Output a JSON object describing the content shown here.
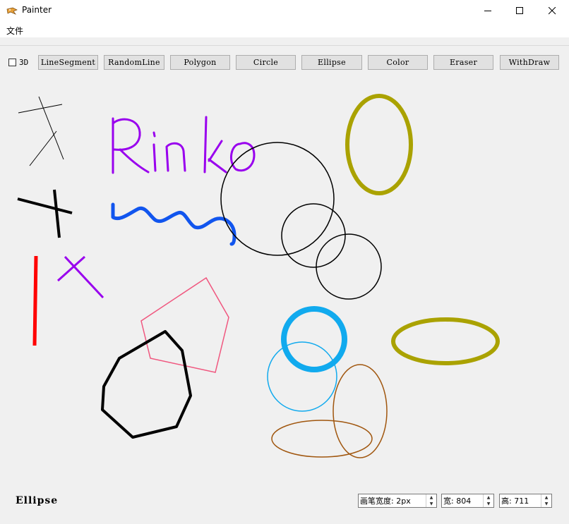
{
  "window": {
    "title": "Painter",
    "app_icon": "painter-app-icon",
    "controls": {
      "minimize_icon": "minimize-icon",
      "maximize_icon": "maximize-icon",
      "close_icon": "close-icon"
    }
  },
  "menu": {
    "file_label": "文件"
  },
  "toolbar": {
    "checkbox_3d": {
      "label": "3D",
      "checked": false
    },
    "buttons": [
      {
        "id": "linesegment",
        "label": "LineSegment"
      },
      {
        "id": "randomline",
        "label": "RandomLine"
      },
      {
        "id": "polygon",
        "label": "Polygon"
      },
      {
        "id": "circle",
        "label": "Circle"
      },
      {
        "id": "ellipse",
        "label": "Ellipse"
      },
      {
        "id": "color",
        "label": "Color"
      },
      {
        "id": "eraser",
        "label": "Eraser"
      },
      {
        "id": "withdraw",
        "label": "WithDraw"
      }
    ]
  },
  "canvas": {
    "drawn_text": "Rinko",
    "colors": {
      "black": "#000000",
      "purple": "#9900ee",
      "blue": "#1155ee",
      "red": "#ff0000",
      "pink": "#f0577f",
      "olive": "#aaa200",
      "cyan": "#11aaee",
      "brown": "#a0560e"
    }
  },
  "status": {
    "current_mode": "Ellipse",
    "pen_width": {
      "label": "画笔宽度:",
      "value": "2px"
    },
    "width": {
      "label": "宽:",
      "value": "804"
    },
    "height": {
      "label": "高:",
      "value": "711"
    }
  }
}
